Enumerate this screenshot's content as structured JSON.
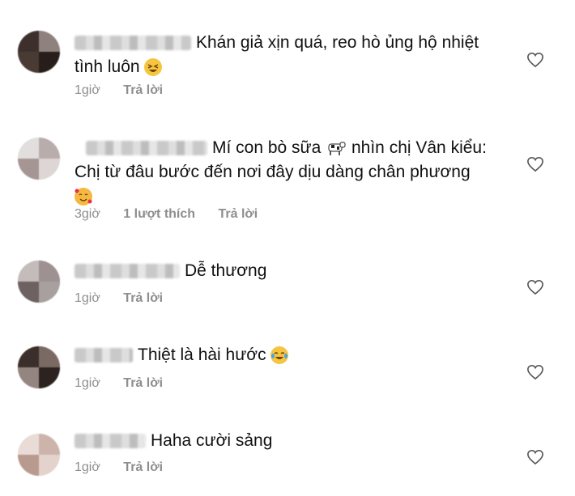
{
  "comments": [
    {
      "text": "Khán giả xịn quá, reo hò ủng hộ nhiệt tình luôn",
      "emoji": "laughing-face",
      "time": "1giờ",
      "likes": "",
      "reply": "Trả lời"
    },
    {
      "text": "Mí con bò sữa",
      "text2": "nhìn chị Vân kiểu: Chị từ đâu bước đến nơi đây dịu dàng chân phương",
      "emoji_inline": "cow",
      "emoji": "smiling-face-with-hearts",
      "time": "3giờ",
      "likes": "1 lượt thích",
      "reply": "Trả lời"
    },
    {
      "text": "Dễ thương",
      "time": "1giờ",
      "likes": "",
      "reply": "Trả lời"
    },
    {
      "text": "Thiệt là hài hước",
      "emoji": "tears-of-joy",
      "time": "1giờ",
      "likes": "",
      "reply": "Trả lời"
    },
    {
      "text": "Haha cười sảng",
      "time": "1giờ",
      "likes": "",
      "reply": "Trả lời"
    }
  ],
  "colors": {
    "text": "#111111",
    "meta": "#8e8e8e",
    "heart": "#555555"
  },
  "icons": {
    "like": "heart-outline-icon"
  }
}
